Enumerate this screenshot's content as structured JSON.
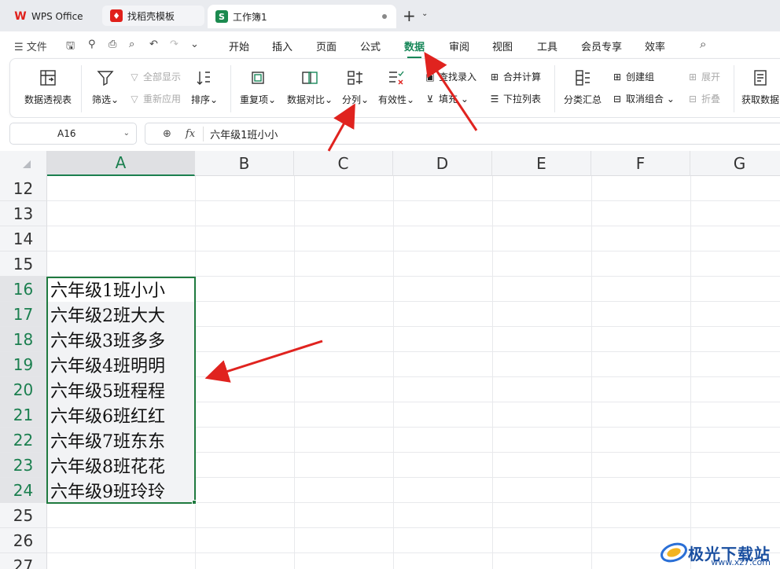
{
  "tabs": {
    "wps": "WPS Office",
    "template": "找稻壳模板",
    "workbook": "工作簿1",
    "workbook_logo": "S"
  },
  "menu": {
    "file": "文件",
    "items": [
      "开始",
      "插入",
      "页面",
      "公式",
      "数据",
      "审阅",
      "视图",
      "工具",
      "会员专享",
      "效率"
    ],
    "active": "数据"
  },
  "ribbon": {
    "pivot": "数据透视表",
    "filter": "筛选",
    "show_all": "全部显示",
    "reapply": "重新应用",
    "sort": "排序",
    "duplicates": "重复项",
    "compare": "数据对比",
    "split": "分列",
    "validity": "有效性",
    "lookup": "查找录入",
    "fill": "填充",
    "consolidate": "合并计算",
    "dropdown": "下拉列表",
    "subtotal": "分类汇总",
    "group": "创建组",
    "ungroup": "取消组合",
    "expand": "展开",
    "collapse": "折叠",
    "get_data": "获取数据"
  },
  "formula_bar": {
    "name_box": "A16",
    "fx": "fx",
    "value": "六年级1班小小"
  },
  "columns": [
    "A",
    "B",
    "C",
    "D",
    "E",
    "F",
    "G"
  ],
  "rows": [
    "12",
    "13",
    "14",
    "15",
    "16",
    "17",
    "18",
    "19",
    "20",
    "21",
    "22",
    "23",
    "24",
    "25",
    "26",
    "27"
  ],
  "cells": [
    "六年级1班小小",
    "六年级2班大大",
    "六年级3班多多",
    "六年级4班明明",
    "六年级5班程程",
    "六年级6班红红",
    "六年级7班东东",
    "六年级8班花花",
    "六年级9班玲玲"
  ],
  "watermark": {
    "name": "极光下载站",
    "url": "www.xz7.com"
  },
  "colors": {
    "accent": "#19885a",
    "selection": "#1f7a3f",
    "arrow": "#e0231f"
  }
}
